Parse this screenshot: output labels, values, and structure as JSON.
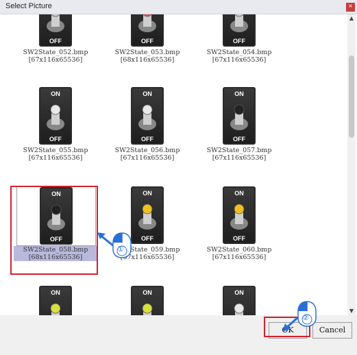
{
  "window": {
    "title": "Select Picture",
    "close_symbol": "×"
  },
  "items": [
    {
      "name": "SW2State_052.bmp",
      "dims": "[67x116x65536]",
      "top_label": "",
      "bottom_label": "OFF",
      "knob": "lever"
    },
    {
      "name": "SW2State_053.bmp",
      "dims": "[68x116x65536]",
      "top_label": "",
      "bottom_label": "OFF",
      "knob": "red"
    },
    {
      "name": "SW2State_054.bmp",
      "dims": "[67x116x65536]",
      "top_label": "",
      "bottom_label": "OFF",
      "knob": "lever"
    },
    {
      "name": "SW2State_055.bmp",
      "dims": "[67x116x65536]",
      "top_label": "ON",
      "bottom_label": "OFF",
      "knob": "white"
    },
    {
      "name": "SW2State_056.bmp",
      "dims": "[67x116x65536]",
      "top_label": "ON",
      "bottom_label": "OFF",
      "knob": "white"
    },
    {
      "name": "SW2State_057.bmp",
      "dims": "[67x116x65536]",
      "top_label": "ON",
      "bottom_label": "OFF",
      "knob": "black"
    },
    {
      "name": "SW2State_058.bmp",
      "dims": "[68x116x65536]",
      "top_label": "ON",
      "bottom_label": "OFF",
      "knob": "black",
      "selected": true
    },
    {
      "name": "SW2State_059.bmp",
      "dims": "[67x116x65536]",
      "top_label": "ON",
      "bottom_label": "OFF",
      "knob": "yellow"
    },
    {
      "name": "SW2State_060.bmp",
      "dims": "[67x116x65536]",
      "top_label": "ON",
      "bottom_label": "OFF",
      "knob": "yellow"
    },
    {
      "name": "",
      "dims": "",
      "top_label": "ON",
      "bottom_label": "",
      "knob": "yellowgreen"
    },
    {
      "name": "",
      "dims": "",
      "top_label": "ON",
      "bottom_label": "",
      "knob": "yellowgreen"
    },
    {
      "name": "",
      "dims": "",
      "top_label": "ON",
      "bottom_label": "",
      "knob": "white"
    }
  ],
  "buttons": {
    "ok": "OK",
    "cancel": "Cancel"
  },
  "annotations": {
    "step1": "①",
    "step2": "②"
  },
  "colors": {
    "highlight": "#d02030",
    "selection": "#b9b9de",
    "arrow": "#2a6fd6"
  }
}
